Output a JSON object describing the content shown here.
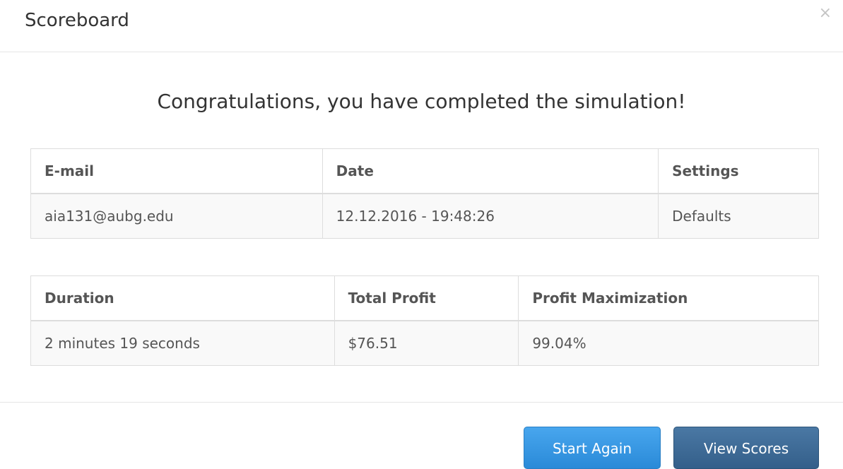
{
  "modal": {
    "title": "Scoreboard",
    "close_glyph": "×",
    "headline": "Congratulations, you have completed the simulation!"
  },
  "summary_table": {
    "headers": [
      "E-mail",
      "Date",
      "Settings"
    ],
    "rows": [
      [
        "aia131@aubg.edu",
        "12.12.2016 - 19:48:26",
        "Defaults"
      ]
    ]
  },
  "results_table": {
    "headers": [
      "Duration",
      "Total Profit",
      "Profit Maximization"
    ],
    "rows": [
      [
        "2 minutes 19 seconds",
        "$76.51",
        "99.04%"
      ]
    ]
  },
  "footer": {
    "start_again_label": "Start Again",
    "view_scores_label": "View Scores"
  },
  "colors": {
    "primary_button": "#2a8ad8",
    "secondary_button": "#345f8a"
  }
}
